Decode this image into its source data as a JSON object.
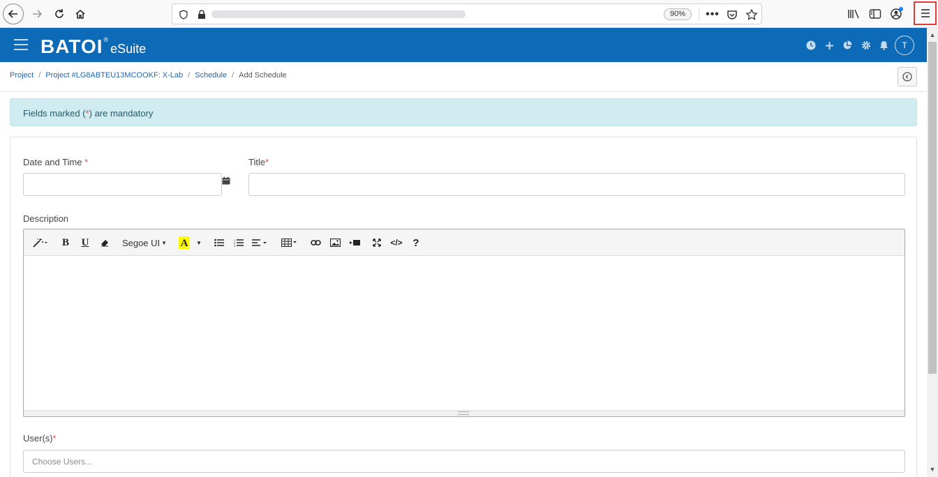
{
  "browser": {
    "zoom": "90%",
    "menu_icon": "hamburger-menu-icon"
  },
  "app": {
    "logo_text": "BATOI",
    "logo_reg": "®",
    "logo_sub": "eSuite",
    "avatar_initial": "T",
    "header_icons": [
      "clock-icon",
      "plus-icon",
      "pie-chart-icon",
      "gear-icon",
      "bell-icon"
    ],
    "brand_color": "#0d6ab7"
  },
  "breadcrumb": {
    "items": [
      "Project",
      "Project #LG8ABTEU13MCOOKF: X-Lab",
      "Schedule"
    ],
    "current": "Add Schedule",
    "separator": "/"
  },
  "alert": {
    "prefix": "Fields marked (",
    "star": "*",
    "suffix": ") are mandatory"
  },
  "form": {
    "date_label": "Date and Time ",
    "title_label": "Title",
    "description_label": "Description",
    "users_label": "User(s)",
    "required_mark": "*",
    "users_placeholder": "Choose Users...",
    "date_value": "",
    "title_value": ""
  },
  "editor": {
    "font_name": "Segoe UI",
    "tools": [
      "magic-wand-icon",
      "bold-icon",
      "underline-icon",
      "eraser-icon",
      "font-family-dropdown",
      "text-color-icon",
      "unordered-list-icon",
      "ordered-list-icon",
      "align-icon",
      "table-icon",
      "link-icon",
      "image-icon",
      "video-icon",
      "fullscreen-icon",
      "code-view-icon",
      "help-icon"
    ]
  }
}
